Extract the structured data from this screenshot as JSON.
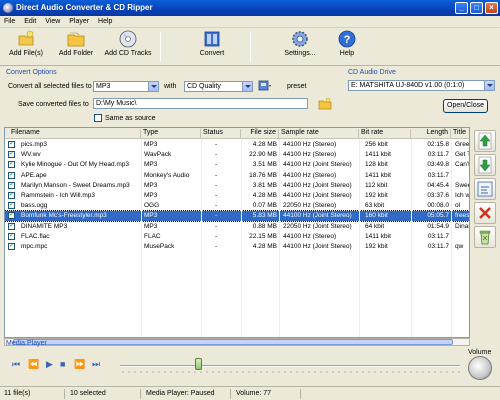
{
  "window": {
    "title": "Direct Audio Converter & CD Ripper",
    "minimize": "_",
    "maximize": "□",
    "close": "×"
  },
  "menu": [
    "File",
    "Edit",
    "View",
    "Player",
    "Help"
  ],
  "toolbar": {
    "add_files": "Add File(s)",
    "add_folder": "Add Folder",
    "add_cd_tracks": "Add CD Tracks",
    "convert": "Convert",
    "settings": "Settings...",
    "help": "Help"
  },
  "convert_options": {
    "group_title": "Convert Options",
    "convert_label": "Convert all selected files to",
    "format_value": "MP3",
    "with_label": "with",
    "quality_value": "CD Quality",
    "preset_label": "preset",
    "save_label": "Save converted files to",
    "save_path": "D:\\My Music\\",
    "same_as_source": "Same as source"
  },
  "cd_drive": {
    "group_title": "CD Audio Drive",
    "drive_value": "E: MATSHITA UJ-840D  v1.00 (0:1:0)",
    "open_close": "Open/Close"
  },
  "columns": [
    "Filename",
    "Type",
    "Status",
    "File size",
    "Sample rate",
    "Bit rate",
    "Length",
    "Title"
  ],
  "files": [
    {
      "name": "pics.mp3",
      "type": "MP3",
      "status": "-",
      "size": "4.28 MB",
      "rate": "44100 Hz (Stereo)",
      "bitrate": "256 kbit",
      "length": "02:15.8",
      "title": "Green",
      "checked": true,
      "selected": false
    },
    {
      "name": "WV.wv",
      "type": "WavPack",
      "status": "-",
      "size": "22.90 MB",
      "rate": "44100 Hz (Stereo)",
      "bitrate": "1411 kbit",
      "length": "03:11.7",
      "title": "Get T",
      "checked": true,
      "selected": false
    },
    {
      "name": "Kylie Minogue - Out Of My Head.mp3",
      "type": "MP3",
      "status": "-",
      "size": "3.51 MB",
      "rate": "44100 Hz (Joint Stereo)",
      "bitrate": "128 kbit",
      "length": "03:49.8",
      "title": "Can't",
      "checked": true,
      "selected": false
    },
    {
      "name": "APE.ape",
      "type": "Monkey's Audio",
      "status": "-",
      "size": "18.76 MB",
      "rate": "44100 Hz (Stereo)",
      "bitrate": "1411 kbit",
      "length": "03:11.7",
      "title": "",
      "checked": true,
      "selected": false
    },
    {
      "name": "Marilyn Manson - Sweet Dreams.mp3",
      "type": "MP3",
      "status": "-",
      "size": "3.81 MB",
      "rate": "44100 Hz (Joint Stereo)",
      "bitrate": "112 kbit",
      "length": "04:45.4",
      "title": "Swee",
      "checked": true,
      "selected": false
    },
    {
      "name": "Rammstein - Ich Will.mp3",
      "type": "MP3",
      "status": "-",
      "size": "4.28 MB",
      "rate": "44100 Hz (Joint Stereo)",
      "bitrate": "192 kbit",
      "length": "03:37.6",
      "title": "Ich wi",
      "checked": true,
      "selected": false
    },
    {
      "name": "bass.ogg",
      "type": "OGG",
      "status": "-",
      "size": "0.07 MB",
      "rate": "22050 Hz (Stereo)",
      "bitrate": "63 kbit",
      "length": "00:08.0",
      "title": "ol",
      "checked": true,
      "selected": false
    },
    {
      "name": "Bomfunk Mc's-Freestyler.mp3",
      "type": "MP3",
      "status": "-",
      "size": "5.83 MB",
      "rate": "44100 Hz (Joint Stereo)",
      "bitrate": "160 kbit",
      "length": "05:05.7",
      "title": "freest",
      "checked": true,
      "selected": true
    },
    {
      "name": "DINAMITE MP3",
      "type": "MP3",
      "status": "-",
      "size": "0.88 MB",
      "rate": "22050 Hz (Joint Stereo)",
      "bitrate": "64 kbit",
      "length": "01:54.9",
      "title": "Dinam",
      "checked": true,
      "selected": false
    },
    {
      "name": "FLAC.flac",
      "type": "FLAC",
      "status": "-",
      "size": "22.15 MB",
      "rate": "44100 Hz (Stereo)",
      "bitrate": "1411 kbit",
      "length": "03:11.7",
      "title": "",
      "checked": true,
      "selected": false
    },
    {
      "name": "mpc.mpc",
      "type": "MusePack",
      "status": "-",
      "size": "4.28 MB",
      "rate": "44100 Hz (Joint Stereo)",
      "bitrate": "192 kbit",
      "length": "03:11.7",
      "title": "qw",
      "checked": true,
      "selected": false
    }
  ],
  "media_player": {
    "label": "Media Player",
    "volume_label": "Volume",
    "position": 0.22
  },
  "status_bar": {
    "file_count": "11 file(s)",
    "selected": "10 selected",
    "player_state": "Media Player: Paused",
    "volume": "Volume: 77"
  },
  "colors": {
    "title_bar": "#0842b8",
    "selection": "#316ac5",
    "group_title": "#2050b0"
  }
}
